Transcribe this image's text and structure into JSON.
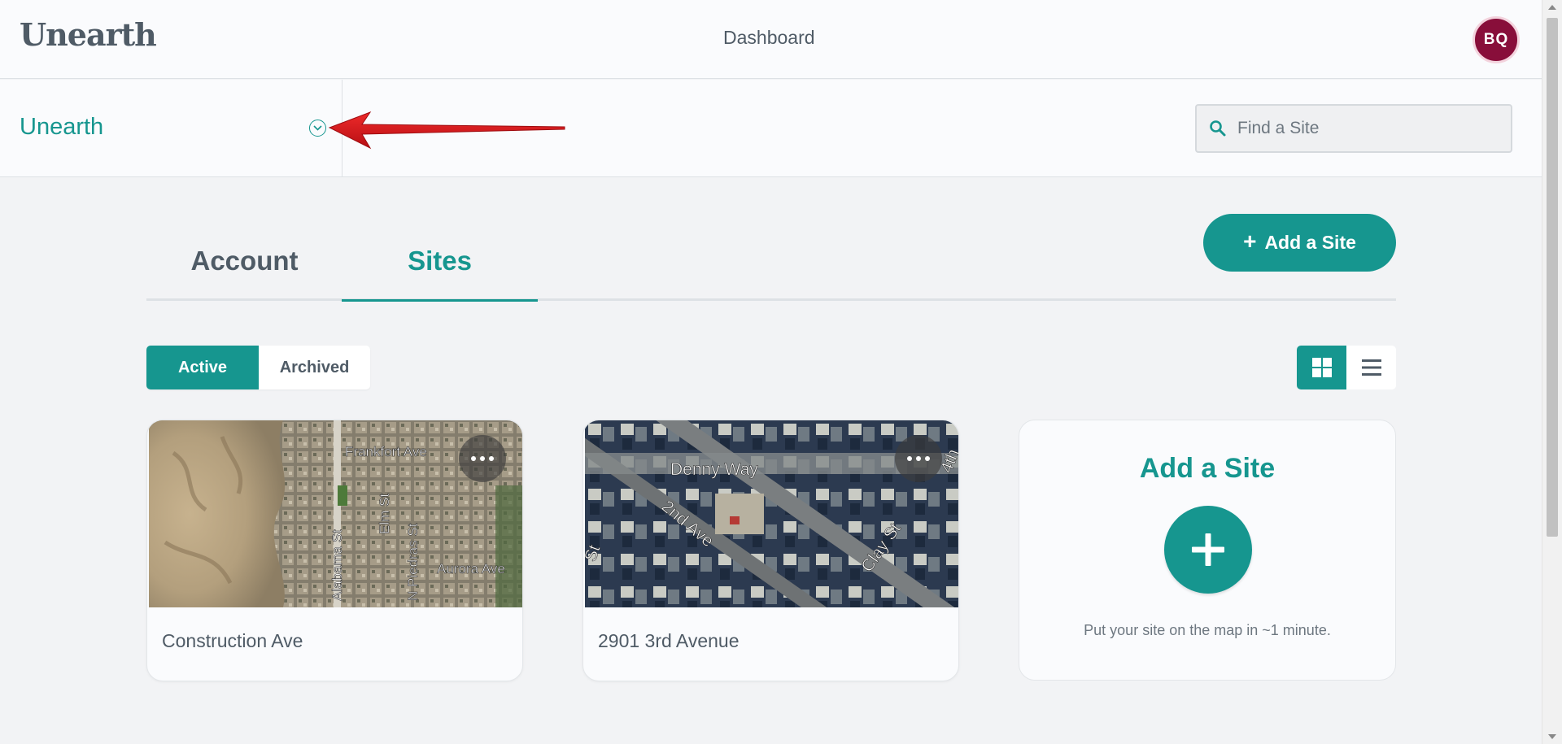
{
  "header": {
    "logo": "Unearth",
    "nav_title": "Dashboard",
    "avatar_initials": "BQ"
  },
  "subheader": {
    "org_name": "Unearth",
    "org_toggle_icon": "chevron-down-circle-icon",
    "search": {
      "placeholder": "Find a Site",
      "value": ""
    }
  },
  "tabs": [
    {
      "label": "Account",
      "active": false
    },
    {
      "label": "Sites",
      "active": true
    }
  ],
  "add_site_button": {
    "label": "Add a Site",
    "icon": "plus-icon"
  },
  "filter": {
    "active_label": "Active",
    "archived_label": "Archived",
    "selected": "Active"
  },
  "view_toggle": {
    "selected": "grid",
    "options": [
      "grid-icon",
      "list-icon"
    ]
  },
  "sites": [
    {
      "name": "Construction Ave",
      "map_labels": [
        "Frankfort Ave",
        "Elm St",
        "Alabama St",
        "N Piedras St",
        "Aurora Ave"
      ]
    },
    {
      "name": "2901 3rd Avenue",
      "map_labels": [
        "Denny Way",
        "2nd Ave",
        "Clay St",
        "St",
        "4th"
      ]
    }
  ],
  "add_card": {
    "title": "Add a Site",
    "description": "Put your site on the map in ~1 minute."
  },
  "colors": {
    "accent": "#16968f",
    "avatar": "#880e3a",
    "text": "#4f5b66",
    "background": "#f2f3f5",
    "annotation_arrow": "#d6151b"
  }
}
